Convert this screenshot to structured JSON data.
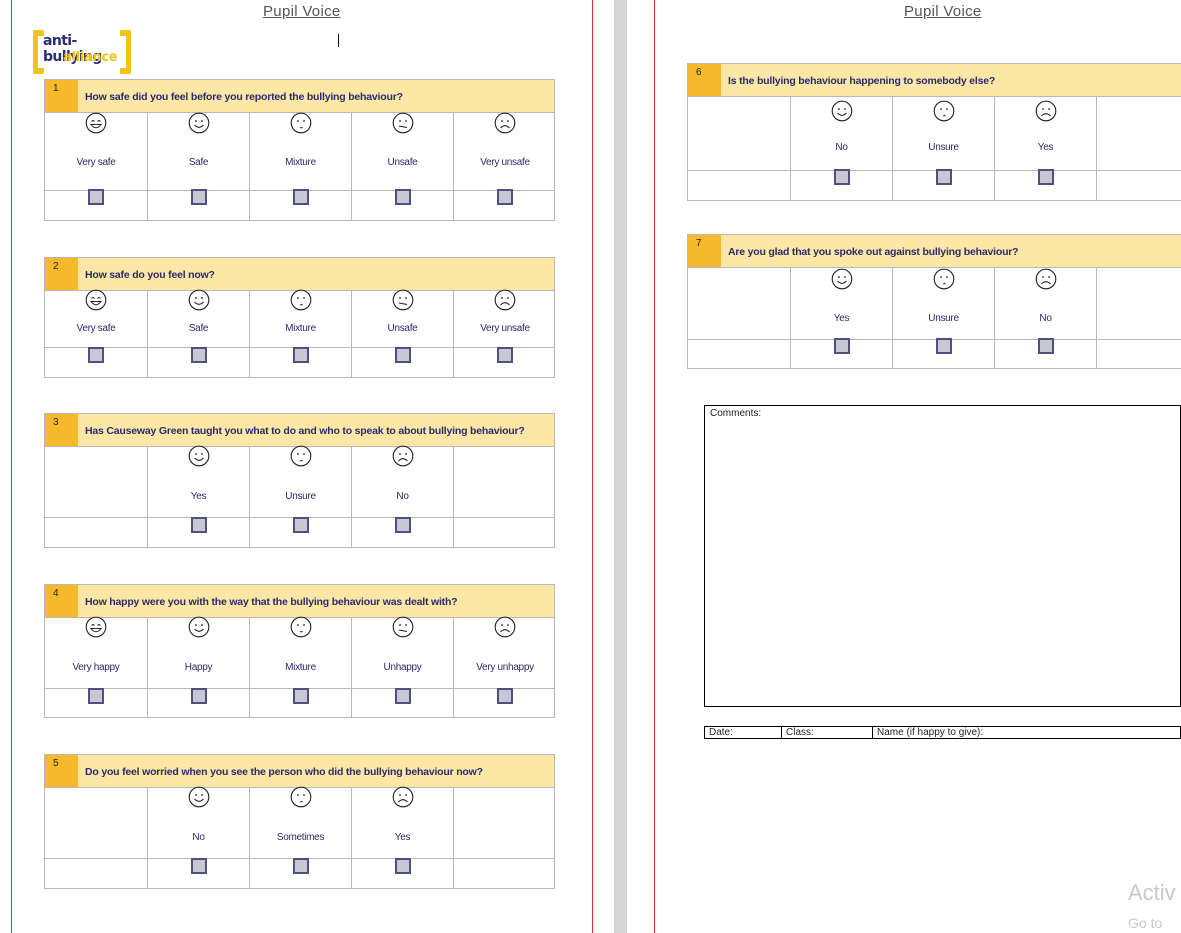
{
  "header": {
    "left": "Pupil Voice",
    "right": "Pupil Voice"
  },
  "logo": {
    "line1": "anti-bullying",
    "line2": "alliance"
  },
  "questions": [
    {
      "number": "1",
      "text": "How safe did you feel before you reported the bullying behaviour?",
      "options": [
        "Very safe",
        "Safe",
        "Mixture",
        "Unsafe",
        "Very unsafe"
      ],
      "faces": [
        "very-happy-face-icon",
        "happy-face-icon",
        "neutral-face-icon",
        "unhappy-face-icon",
        "sad-face-icon"
      ]
    },
    {
      "number": "2",
      "text": "How safe do you feel now?",
      "options": [
        "Very safe",
        "Safe",
        "Mixture",
        "Unsafe",
        "Very unsafe"
      ],
      "faces": [
        "very-happy-face-icon",
        "happy-face-icon",
        "neutral-face-icon",
        "unhappy-face-icon",
        "sad-face-icon"
      ]
    },
    {
      "number": "3",
      "text": "Has Causeway Green taught you what to do and who to speak to about bullying behaviour?",
      "options": [
        "Yes",
        "Unsure",
        "No"
      ],
      "faces": [
        "happy-face-icon",
        "neutral-face-icon",
        "sad-face-icon"
      ]
    },
    {
      "number": "4",
      "text": "How happy were you with the way that the bullying behaviour was dealt with?",
      "options": [
        "Very happy",
        "Happy",
        "Mixture",
        "Unhappy",
        "Very unhappy"
      ],
      "faces": [
        "very-happy-face-icon",
        "happy-face-icon",
        "neutral-face-icon",
        "unhappy-face-icon",
        "sad-face-icon"
      ]
    },
    {
      "number": "5",
      "text": "Do you feel worried when you see the person who did the bullying behaviour now?",
      "options": [
        "No",
        "Sometimes",
        "Yes"
      ],
      "faces": [
        "happy-face-icon",
        "neutral-face-icon",
        "sad-face-icon"
      ]
    },
    {
      "number": "6",
      "text": "Is the bullying behaviour happening to somebody else?",
      "options": [
        "No",
        "Unsure",
        "Yes"
      ],
      "faces": [
        "happy-face-icon",
        "neutral-face-icon",
        "sad-face-icon"
      ]
    },
    {
      "number": "7",
      "text": "Are you glad that you spoke out against bullying behaviour?",
      "options": [
        "Yes",
        "Unsure",
        "No"
      ],
      "faces": [
        "happy-face-icon",
        "neutral-face-icon",
        "sad-face-icon"
      ]
    }
  ],
  "comments": {
    "label": "Comments:"
  },
  "footer": {
    "date": "Date:",
    "class": "Class:",
    "name": "Name (if happy to give):"
  },
  "watermark": {
    "line1": "Activ",
    "line2": "Go to"
  },
  "colors": {
    "header_band": "#fde7a6",
    "number_cell": "#f5b92b",
    "text_blue": "#2a2a6a",
    "margin_line": "#e03030"
  }
}
